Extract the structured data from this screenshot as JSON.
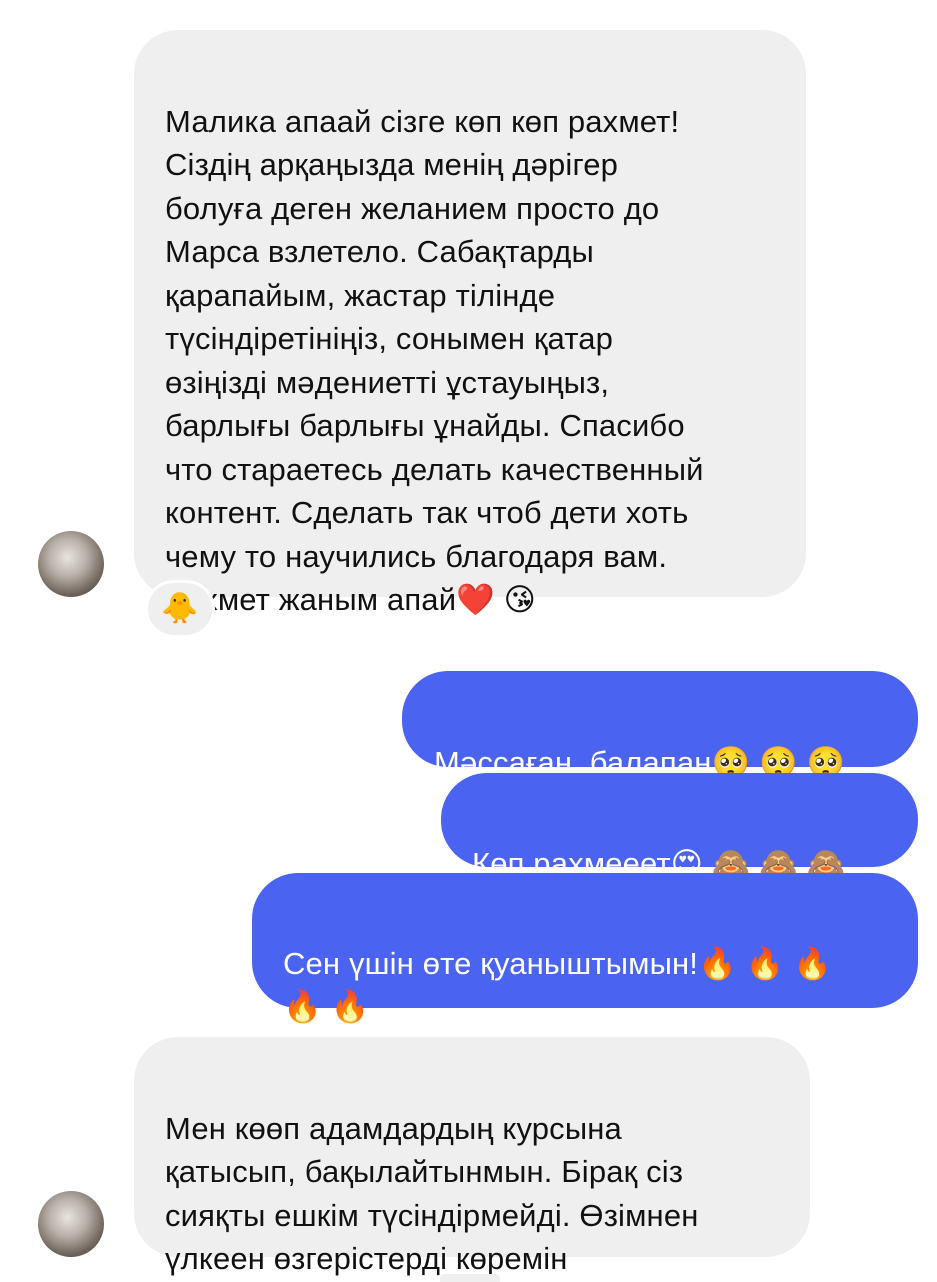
{
  "conversation": {
    "messages": [
      {
        "direction": "incoming",
        "text": "Малика апаай сізге көп көп рахмет!\nСіздің арқаңызда менің дәрігер\nболуға деген желанием просто до\nМарса взлетело.  Сабақтарды\nқарапайым,  жастар тілінде\nтүсіндіретініңіз, сонымен қатар\nөзіңізді мәдениетті ұстауыңыз,\nбарлығы барлығы ұнайды.  Спасибо\nчто стараетесь делать качественный\nконтент.  Сделать так чтоб дети хоть\nчему то научились благодаря вам.\nРахмет жаным апай❤️ 😘",
        "reaction": "🐥"
      },
      {
        "direction": "outgoing",
        "text": "Мәссаған, балапан🥺 🥺 🥺"
      },
      {
        "direction": "outgoing",
        "text": "Көп рахмееет😍 🙈 🙈 🙈"
      },
      {
        "direction": "outgoing",
        "text": "Сен үшін өте қуаныштымын!🔥 🔥 🔥\n🔥 🔥"
      },
      {
        "direction": "incoming",
        "text": "Мен көөп адамдардың курсына\nқатысып,  бақылайтынмын. Бірақ сіз\nсияқты ешкім түсіндірмейді. Өзімнен\nүлкеен өзгерістерді көремін"
      }
    ]
  },
  "colors": {
    "incoming_bubble": "#efefef",
    "outgoing_bubble": "#4a63f0",
    "incoming_text": "#111111",
    "outgoing_text": "#ffffff"
  },
  "icons": {
    "avatar": "sender-avatar-photo",
    "reaction": "hatching-chick-emoji"
  }
}
